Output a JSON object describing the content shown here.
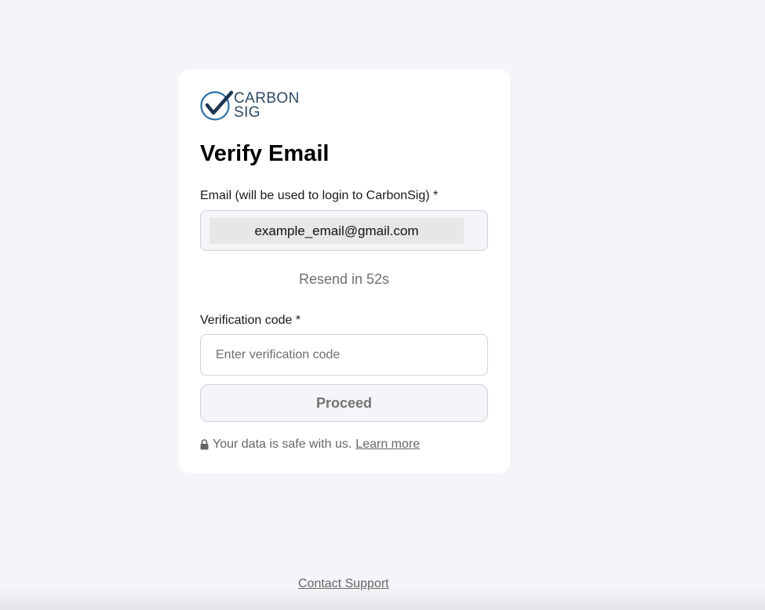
{
  "brand": {
    "logo_line1": "CARBON",
    "logo_line2": "SIG",
    "logo_icon": "checkmark-circle-icon",
    "colors": {
      "logo_circle": "#2b6fa6",
      "logo_check": "#1f3550",
      "logo_text": "#2c4a63"
    }
  },
  "form": {
    "title": "Verify Email",
    "email_label": "Email (will be used to login to CarbonSig) *",
    "email_value": "example_email@gmail.com",
    "resend_text": "Resend in 52s",
    "code_label": "Verification code *",
    "code_placeholder": "Enter verification code",
    "code_value": "",
    "proceed_label": "Proceed"
  },
  "footer_note": {
    "lock_icon": "lock-icon",
    "text": "Your data is safe with us.",
    "link_label": "Learn more"
  },
  "page_footer": {
    "contact_support": "Contact Support"
  }
}
